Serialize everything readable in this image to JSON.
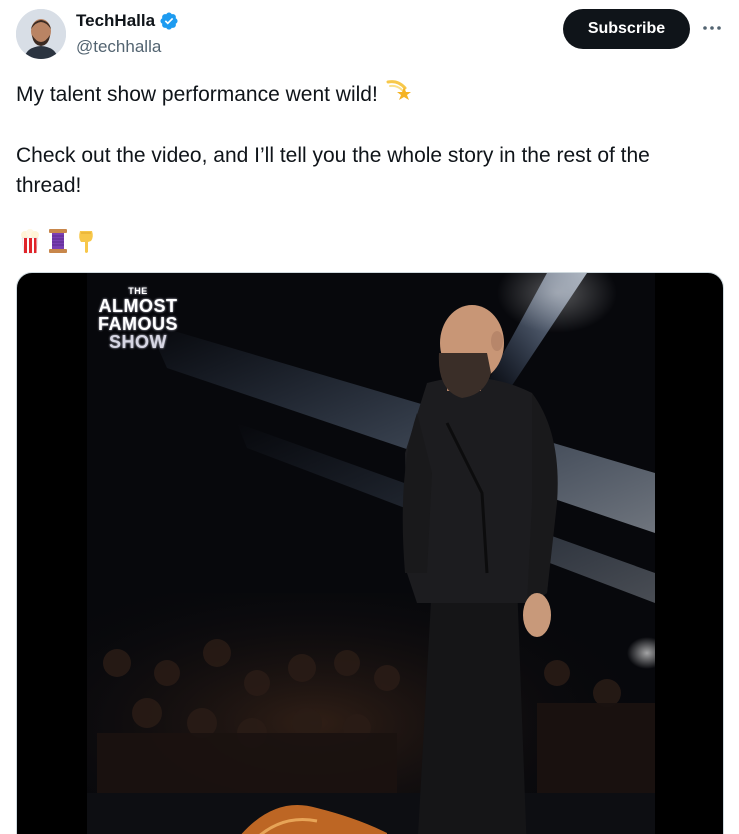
{
  "author": {
    "display_name": "TechHalla",
    "handle": "@techhalla",
    "verified_icon": "verified-badge-icon",
    "verified_color": "#1d9bf0"
  },
  "header": {
    "subscribe_label": "Subscribe",
    "more_icon": "more-horizontal-icon"
  },
  "tweet": {
    "line1": "My talent show performance went wild!",
    "line1_emoji": "shooting-star-emoji",
    "line2": "Check out the video, and I’ll tell you the whole story in the rest of the thread!",
    "emojis": [
      "popcorn-emoji",
      "thread-spool-emoji",
      "pointing-down-emoji"
    ]
  },
  "media": {
    "type": "video",
    "logo": {
      "line1": "THE",
      "line2": "ALMOST",
      "line3": "FAMOUS",
      "line4": "SHOW"
    }
  },
  "colors": {
    "text_primary": "#0f1419",
    "text_secondary": "#536471",
    "button_bg": "#0f1419",
    "border": "#cfd9de"
  }
}
